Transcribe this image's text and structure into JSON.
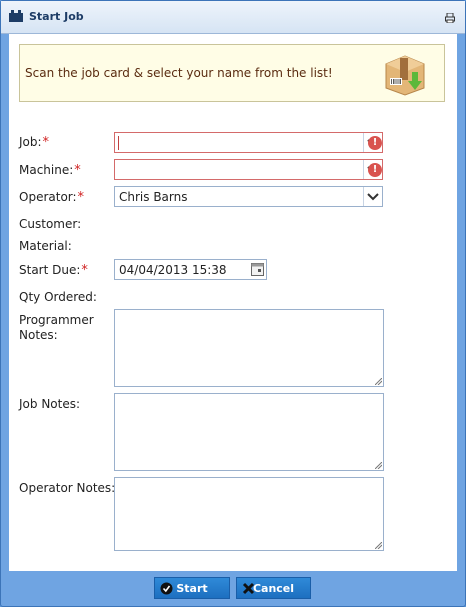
{
  "window": {
    "title": "Start Job"
  },
  "banner": {
    "text": "Scan the job card & select your name from the list!"
  },
  "form": {
    "job_label": "Job:",
    "job_value": "",
    "machine_label": "Machine:",
    "machine_value": "",
    "operator_label": "Operator:",
    "operator_value": "Chris Barns",
    "customer_label": "Customer:",
    "material_label": "Material:",
    "start_due_label": "Start Due:",
    "start_due_value": "04/04/2013 15:38",
    "qty_label": "Qty Ordered:",
    "programmer_notes_label_1": "Programmer",
    "programmer_notes_label_2": "Notes:",
    "job_notes_label": "Job Notes:",
    "operator_notes_label": "Operator Notes:",
    "required_mark": "*",
    "warn_glyph": "!"
  },
  "buttons": {
    "start_label": "Start",
    "cancel_label": "Cancel"
  },
  "colors": {
    "accent": "#1d6fc0",
    "required": "#d02020",
    "error": "#d9534f",
    "banner_bg": "#fffde6"
  },
  "icons": [
    "window-icon",
    "print-icon",
    "package-icon",
    "warning-icon",
    "calendar-icon",
    "check-icon",
    "cross-icon"
  ]
}
